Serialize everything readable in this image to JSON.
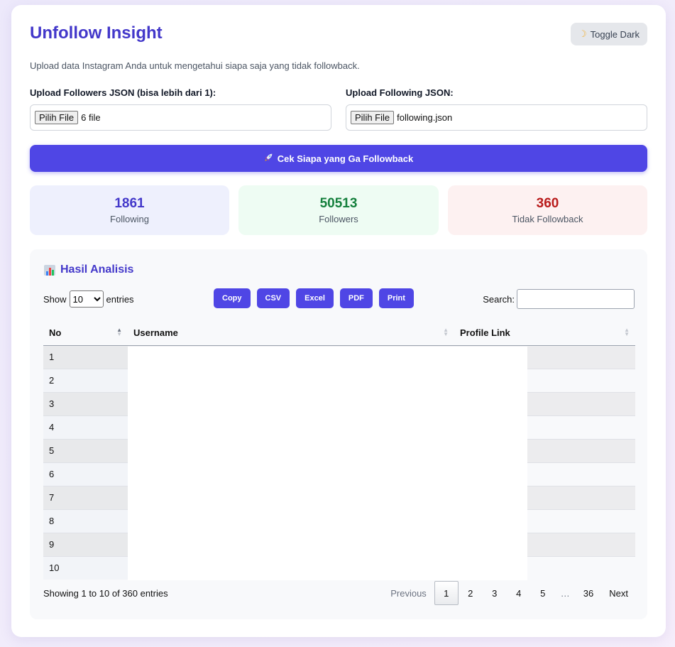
{
  "header": {
    "title": "Unfollow Insight",
    "toggle_label": "Toggle Dark",
    "toggle_icon": "moon-icon",
    "subtitle": "Upload data Instagram Anda untuk mengetahui siapa saja yang tidak followback."
  },
  "upload": {
    "followers_label": "Upload Followers JSON (bisa lebih dari 1):",
    "followers_button": "Pilih File",
    "followers_value": "6 file",
    "following_label": "Upload Following JSON:",
    "following_button": "Pilih File",
    "following_value": "following.json"
  },
  "action": {
    "button_label": "Cek Siapa yang Ga Followback",
    "button_icon": "rocket-icon"
  },
  "stats": {
    "following": {
      "value": "1861",
      "label": "Following",
      "color": "#4338ca",
      "bg": "#eef0fd"
    },
    "followers": {
      "value": "50513",
      "label": "Followers",
      "color": "#15803d",
      "bg": "#eefcf3"
    },
    "not_followback": {
      "value": "360",
      "label": "Tidak Followback",
      "color": "#b91c1c",
      "bg": "#fdf1f1"
    }
  },
  "results": {
    "title": "Hasil Analisis",
    "title_icon": "bar-chart-icon",
    "show_label": "Show",
    "entries_label": "entries",
    "page_length": "10",
    "export_buttons": [
      "Copy",
      "CSV",
      "Excel",
      "PDF",
      "Print"
    ],
    "search_label": "Search:",
    "search_value": "",
    "columns": [
      "No",
      "Username",
      "Profile Link"
    ],
    "rows": [
      "1",
      "2",
      "3",
      "4",
      "5",
      "6",
      "7",
      "8",
      "9",
      "10"
    ],
    "info": "Showing 1 to 10 of 360 entries",
    "pagination": {
      "previous": "Previous",
      "pages": [
        "1",
        "2",
        "3",
        "4",
        "5"
      ],
      "ellipsis": "…",
      "last": "36",
      "next": "Next",
      "current": "1"
    }
  },
  "accent_color": "#4f46e5"
}
